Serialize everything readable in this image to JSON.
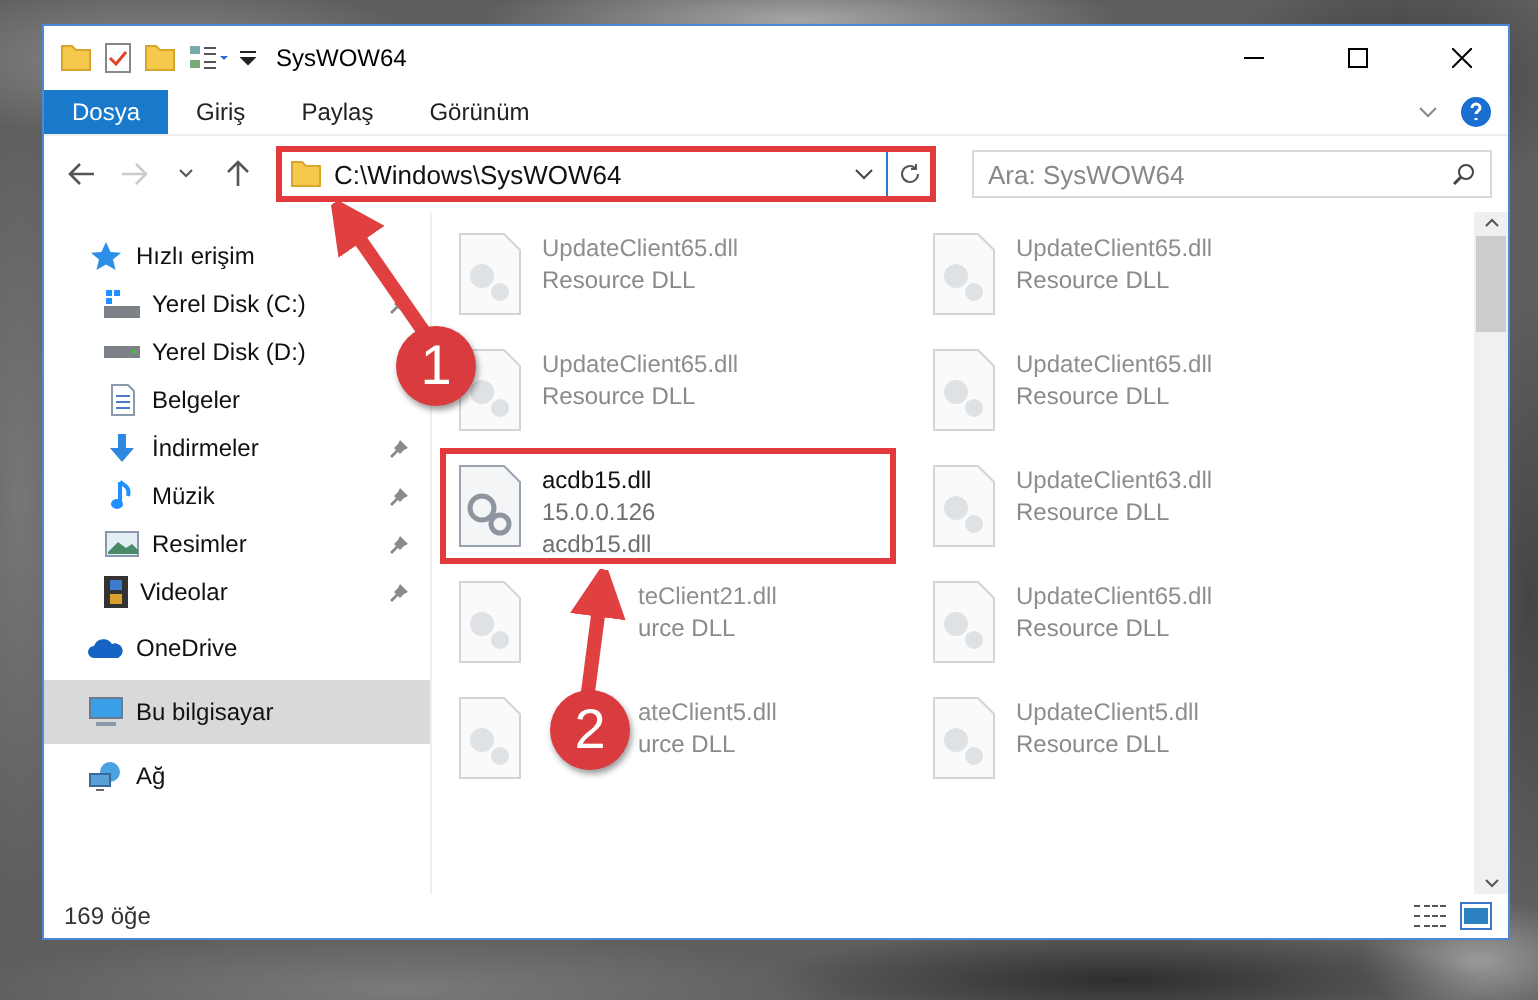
{
  "window": {
    "title": "SysWOW64"
  },
  "ribbon_tabs": [
    {
      "label": "Dosya",
      "selected": true
    },
    {
      "label": "Giriş",
      "selected": false
    },
    {
      "label": "Paylaş",
      "selected": false
    },
    {
      "label": "Görünüm",
      "selected": false
    }
  ],
  "address_bar": {
    "path": "C:\\Windows\\SysWOW64",
    "highlighted": true
  },
  "search": {
    "placeholder": "Ara: SysWOW64"
  },
  "sidebar": {
    "items": [
      {
        "label": "Hızlı erişim",
        "kind": "quick-access",
        "selected": false,
        "children": [
          {
            "label": "Yerel Disk (C:)",
            "kind": "drive-windows",
            "pinned": true
          },
          {
            "label": "Yerel Disk (D:)",
            "kind": "drive",
            "pinned": false
          },
          {
            "label": "Belgeler",
            "kind": "documents",
            "pinned": false
          },
          {
            "label": "İndirmeler",
            "kind": "downloads",
            "pinned": true
          },
          {
            "label": "Müzik",
            "kind": "music",
            "pinned": true
          },
          {
            "label": "Resimler",
            "kind": "pictures",
            "pinned": true
          },
          {
            "label": "Videolar",
            "kind": "videos",
            "pinned": true
          }
        ]
      },
      {
        "label": "OneDrive",
        "kind": "cloud",
        "selected": false
      },
      {
        "label": "Bu bilgisayar",
        "kind": "computer",
        "selected": true
      },
      {
        "label": "Ağ",
        "kind": "network",
        "selected": false
      }
    ]
  },
  "files": [
    {
      "name": "UpdateClient65.dll",
      "lines": [
        "Resource DLL"
      ],
      "faded": true,
      "highlighted": false,
      "partly_covered": false
    },
    {
      "name": "UpdateClient65.dll",
      "lines": [
        "Resource DLL"
      ],
      "faded": true,
      "highlighted": false,
      "partly_covered": false
    },
    {
      "name": "UpdateClient65.dll",
      "lines": [
        "Resource DLL"
      ],
      "faded": true,
      "highlighted": false,
      "partly_covered": false
    },
    {
      "name": "UpdateClient65.dll",
      "lines": [
        "Resource DLL"
      ],
      "faded": true,
      "highlighted": false,
      "partly_covered": false
    },
    {
      "name": "acdb15.dll",
      "lines": [
        "15.0.0.126",
        "acdb15.dll"
      ],
      "faded": false,
      "highlighted": true,
      "partly_covered": false
    },
    {
      "name": "UpdateClient63.dll",
      "lines": [
        "Resource DLL"
      ],
      "faded": true,
      "highlighted": false,
      "partly_covered": false
    },
    {
      "name": "teClient21.dll",
      "lines": [
        "urce DLL"
      ],
      "faded": true,
      "highlighted": false,
      "partly_covered": true
    },
    {
      "name": "UpdateClient65.dll",
      "lines": [
        "Resource DLL"
      ],
      "faded": true,
      "highlighted": false,
      "partly_covered": false
    },
    {
      "name": "ateClient5.dll",
      "lines": [
        "urce DLL"
      ],
      "faded": true,
      "highlighted": false,
      "partly_covered": true
    },
    {
      "name": "UpdateClient5.dll",
      "lines": [
        "Resource DLL"
      ],
      "faded": true,
      "highlighted": false,
      "partly_covered": false
    }
  ],
  "status_bar": {
    "count": "169 öğe"
  },
  "callouts": [
    {
      "number": "1"
    },
    {
      "number": "2"
    }
  ]
}
